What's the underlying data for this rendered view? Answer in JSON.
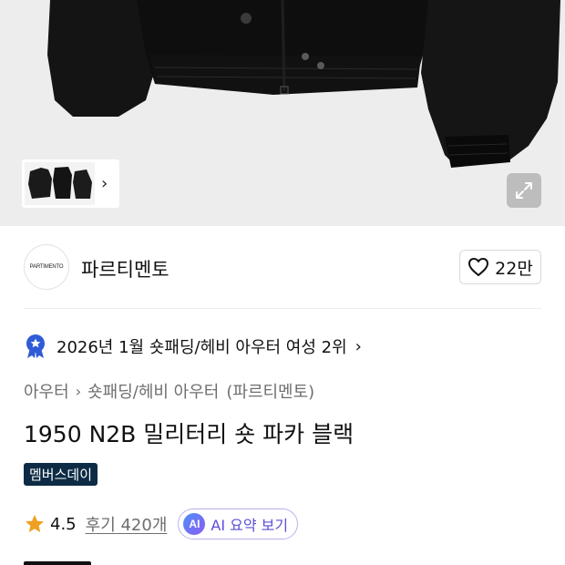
{
  "hero": {
    "thumbnail_icon": "jacket-thumbnails",
    "thumbnail_chevron": "›",
    "expand_icon": "expand-icon"
  },
  "brand": {
    "logo_text": "PARTIMENTO",
    "name": "파르티멘토",
    "likes": "22만"
  },
  "ranking": {
    "text": "2026년 1월 숏패딩/헤비 아우터 여성 2위",
    "chevron": "›",
    "badge_color": "#2f5bd6"
  },
  "breadcrumb": {
    "category": "아우터",
    "subcategory": "숏패딩/헤비 아우터",
    "brand": "(파르티멘토)",
    "separator": "›"
  },
  "product": {
    "title": "1950 N2B 밀리터리 숏 파카 블랙",
    "tag": "멤버스데이"
  },
  "reviews": {
    "rating": "4.5",
    "count_label": "후기 420개",
    "star_color": "#f0a020"
  },
  "ai_summary": {
    "badge": "AI",
    "label": "AI 요약 보기"
  }
}
